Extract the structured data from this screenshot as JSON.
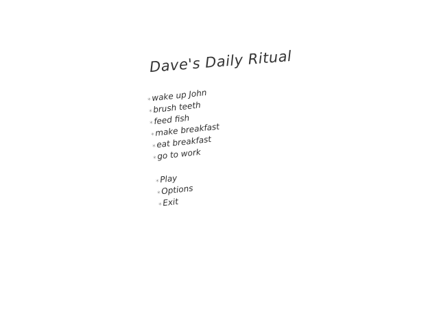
{
  "title": "Dave's Daily Ritual",
  "bullet": "∗",
  "tasks": [
    "wake up John",
    "brush teeth",
    "feed fish",
    "make breakfast",
    "eat breakfast",
    "go to work"
  ],
  "menu": {
    "play_label": "Play",
    "options_label": "Options",
    "exit_label": "Exit"
  }
}
